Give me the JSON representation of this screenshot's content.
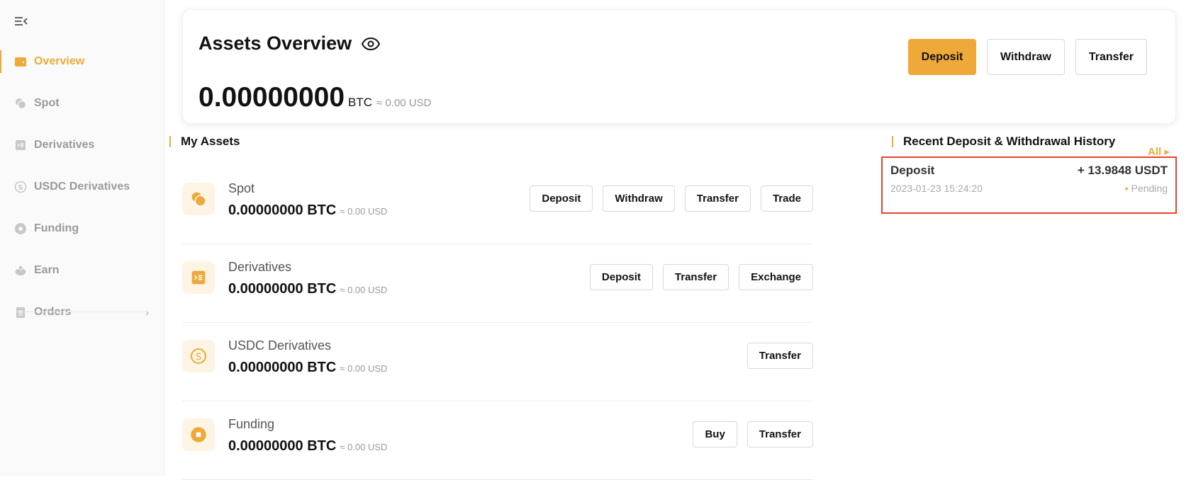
{
  "sidebar": {
    "items": [
      {
        "label": "Overview",
        "icon": "wallet-icon",
        "active": true
      },
      {
        "label": "Spot",
        "icon": "coins-icon"
      },
      {
        "label": "Derivatives",
        "icon": "derivatives-icon"
      },
      {
        "label": "USDC Derivatives",
        "icon": "usdc-icon"
      },
      {
        "label": "Funding",
        "icon": "funding-icon"
      },
      {
        "label": "Earn",
        "icon": "piggy-bank-icon"
      },
      {
        "label": "Orders",
        "icon": "clipboard-icon",
        "chevron": "›"
      }
    ]
  },
  "overview": {
    "title": "Assets Overview",
    "balance": "0.00000000",
    "unit": "BTC",
    "usd": "≈ 0.00 USD",
    "buttons": {
      "deposit": "Deposit",
      "withdraw": "Withdraw",
      "transfer": "Transfer"
    }
  },
  "my_assets": {
    "title": "My Assets",
    "rows": [
      {
        "name": "Spot",
        "amount": "0.00000000 BTC",
        "usd": "≈ 0.00 USD",
        "actions": [
          "Deposit",
          "Withdraw",
          "Transfer",
          "Trade"
        ]
      },
      {
        "name": "Derivatives",
        "amount": "0.00000000 BTC",
        "usd": "≈ 0.00 USD",
        "actions": [
          "Deposit",
          "Transfer",
          "Exchange"
        ]
      },
      {
        "name": "USDC Derivatives",
        "amount": "0.00000000 BTC",
        "usd": "≈ 0.00 USD",
        "actions": [
          "Transfer"
        ]
      },
      {
        "name": "Funding",
        "amount": "0.00000000 BTC",
        "usd": "≈ 0.00 USD",
        "actions": [
          "Buy",
          "Transfer"
        ]
      }
    ]
  },
  "history": {
    "title": "Recent Deposit & Withdrawal History",
    "all_link": "All ▸",
    "items": [
      {
        "type": "Deposit",
        "amount": "+ 13.9848 USDT",
        "time": "2023-01-23 15:24:20",
        "status": "Pending"
      }
    ]
  },
  "colors": {
    "accent": "#eea938",
    "highlight": "#e8412f"
  }
}
